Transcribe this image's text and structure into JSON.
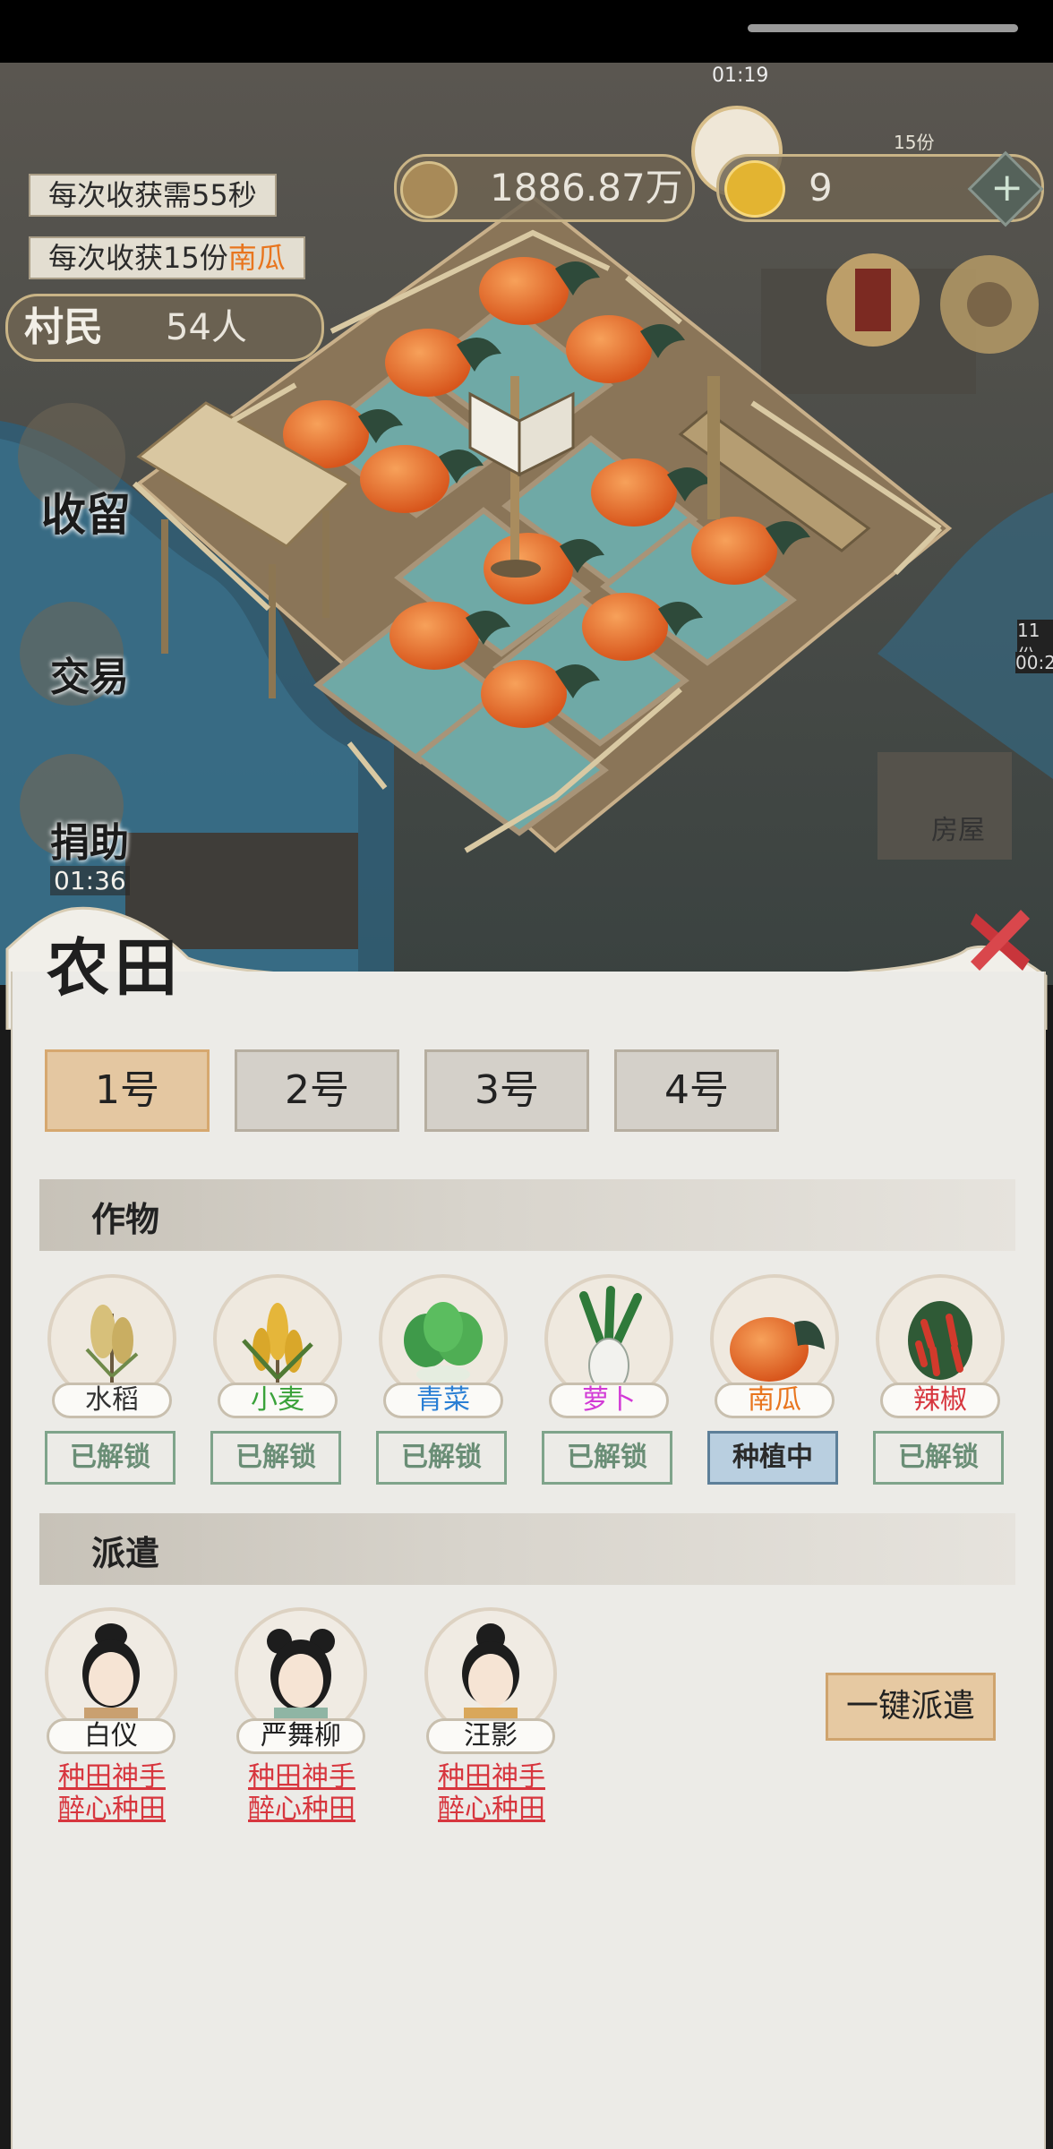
{
  "hud": {
    "harvest_time": "每次收获需55秒",
    "harvest_amount_prefix": "每次收获15份",
    "harvest_crop": "南瓜",
    "villagers_label": "村民",
    "villagers_count": "54人",
    "copper": "1886.87万",
    "gold": "9",
    "timer_top": "01:19",
    "portions": "15份",
    "side_timer": "01:36",
    "edge_numbers": [
      "11份",
      "00:2"
    ],
    "house_label": "房屋"
  },
  "side_menu": [
    {
      "label": "收留"
    },
    {
      "label": "交易"
    },
    {
      "label": "捐助"
    }
  ],
  "panel": {
    "title": "农田",
    "tabs": [
      {
        "label": "1号",
        "active": true
      },
      {
        "label": "2号",
        "active": false
      },
      {
        "label": "3号",
        "active": false
      },
      {
        "label": "4号",
        "active": false
      }
    ],
    "crops_section": "作物",
    "crops": [
      {
        "name": "水稻",
        "status": "已解锁",
        "name_color": "#333333",
        "icon": "rice-icon"
      },
      {
        "name": "小麦",
        "status": "已解锁",
        "name_color": "#3aa23a",
        "icon": "wheat-icon"
      },
      {
        "name": "青菜",
        "status": "已解锁",
        "name_color": "#2a7fd4",
        "icon": "greens-icon"
      },
      {
        "name": "萝卜",
        "status": "已解锁",
        "name_color": "#d23ad6",
        "icon": "radish-icon"
      },
      {
        "name": "南瓜",
        "status": "种植中",
        "name_color": "#e8751e",
        "icon": "pumpkin-icon"
      },
      {
        "name": "辣椒",
        "status": "已解锁",
        "name_color": "#d7363e",
        "icon": "pepper-icon"
      }
    ],
    "dispatch_section": "派遣",
    "workers": [
      {
        "name": "白仪",
        "tags": [
          "种田神手",
          "醉心种田"
        ]
      },
      {
        "name": "严舞柳",
        "tags": [
          "种田神手",
          "醉心种田"
        ]
      },
      {
        "name": "汪影",
        "tags": [
          "种田神手",
          "醉心种田"
        ]
      }
    ],
    "dispatch_button": "一键派遣"
  }
}
